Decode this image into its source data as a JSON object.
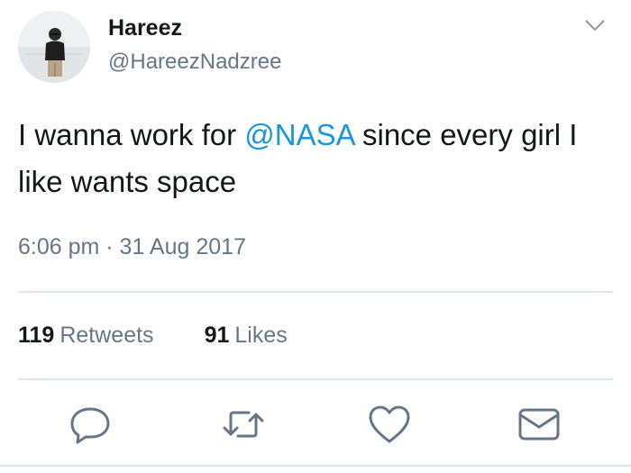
{
  "tweet": {
    "author": {
      "name": "Hareez",
      "handle": "@HareezNadzree"
    },
    "text": {
      "before_mention": "I wanna work for ",
      "mention": "@NASA",
      "after_mention": " since every girl I like wants space"
    },
    "timestamp": "6:06 pm · 31 Aug 2017",
    "stats": {
      "retweets_count": "119",
      "retweets_label": "Retweets",
      "likes_count": "91",
      "likes_label": "Likes"
    },
    "actions": [
      "reply-icon",
      "retweet-icon",
      "like-icon",
      "direct-message-icon"
    ],
    "colors": {
      "text": "#14171a",
      "secondary": "#657786",
      "link": "#1b95e0",
      "divider": "#e1e8ed"
    }
  }
}
